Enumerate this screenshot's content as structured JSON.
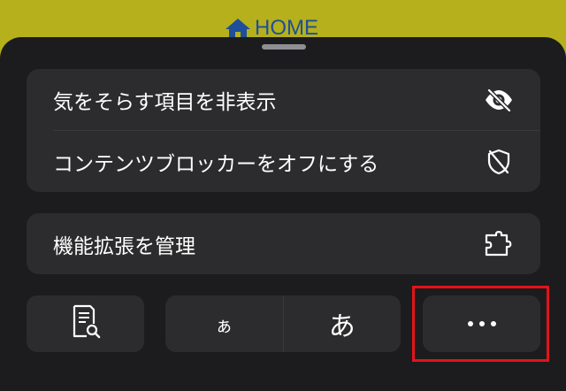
{
  "header": {
    "home_label": "HOME",
    "home_icon": "house-icon",
    "background_color": "#b5b01c",
    "link_color": "#1f4e9a"
  },
  "sheet": {
    "background_color": "#1c1c1e",
    "group_color": "#2c2c2e",
    "group1": {
      "items": [
        {
          "label": "気をそらす項目を非表示",
          "icon": "eye-slash-icon"
        },
        {
          "label": "コンテンツブロッカーをオフにする",
          "icon": "shield-slash-icon"
        }
      ]
    },
    "group2": {
      "items": [
        {
          "label": "機能拡張を管理",
          "icon": "puzzle-piece-icon"
        }
      ]
    },
    "bottom_buttons": {
      "reader_icon": "doc-magnifier-icon",
      "text_smaller_label": "ぁ",
      "text_larger_label": "あ",
      "more_icon": "ellipsis-icon"
    }
  },
  "highlight": {
    "color": "#e3131b",
    "target": "more-button"
  }
}
